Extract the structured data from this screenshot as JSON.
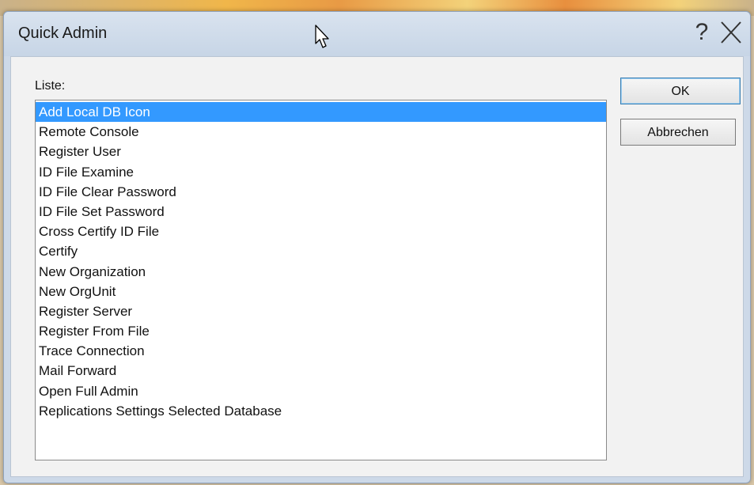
{
  "dialog": {
    "title": "Quick Admin",
    "help_glyph": "?",
    "list_label": "Liste:",
    "items": [
      {
        "label": "Add Local DB Icon",
        "selected": true
      },
      {
        "label": "Remote Console"
      },
      {
        "label": "Register User"
      },
      {
        "label": "ID File Examine"
      },
      {
        "label": "ID File Clear Password"
      },
      {
        "label": "ID File Set Password"
      },
      {
        "label": "Cross Certify ID File"
      },
      {
        "label": "Certify"
      },
      {
        "label": "New Organization"
      },
      {
        "label": "New OrgUnit"
      },
      {
        "label": "Register Server"
      },
      {
        "label": "Register From File"
      },
      {
        "label": "Trace Connection"
      },
      {
        "label": "Mail Forward"
      },
      {
        "label": "Open Full Admin"
      },
      {
        "label": "Replications Settings Selected Database"
      }
    ],
    "ok_label": "OK",
    "cancel_label": "Abbrechen"
  },
  "icons": {
    "help": "help-icon",
    "close": "close-icon",
    "cursor": "mouse-cursor-icon"
  },
  "colors": {
    "selection": "#3399ff",
    "titlebar": "#c7d5e6"
  }
}
